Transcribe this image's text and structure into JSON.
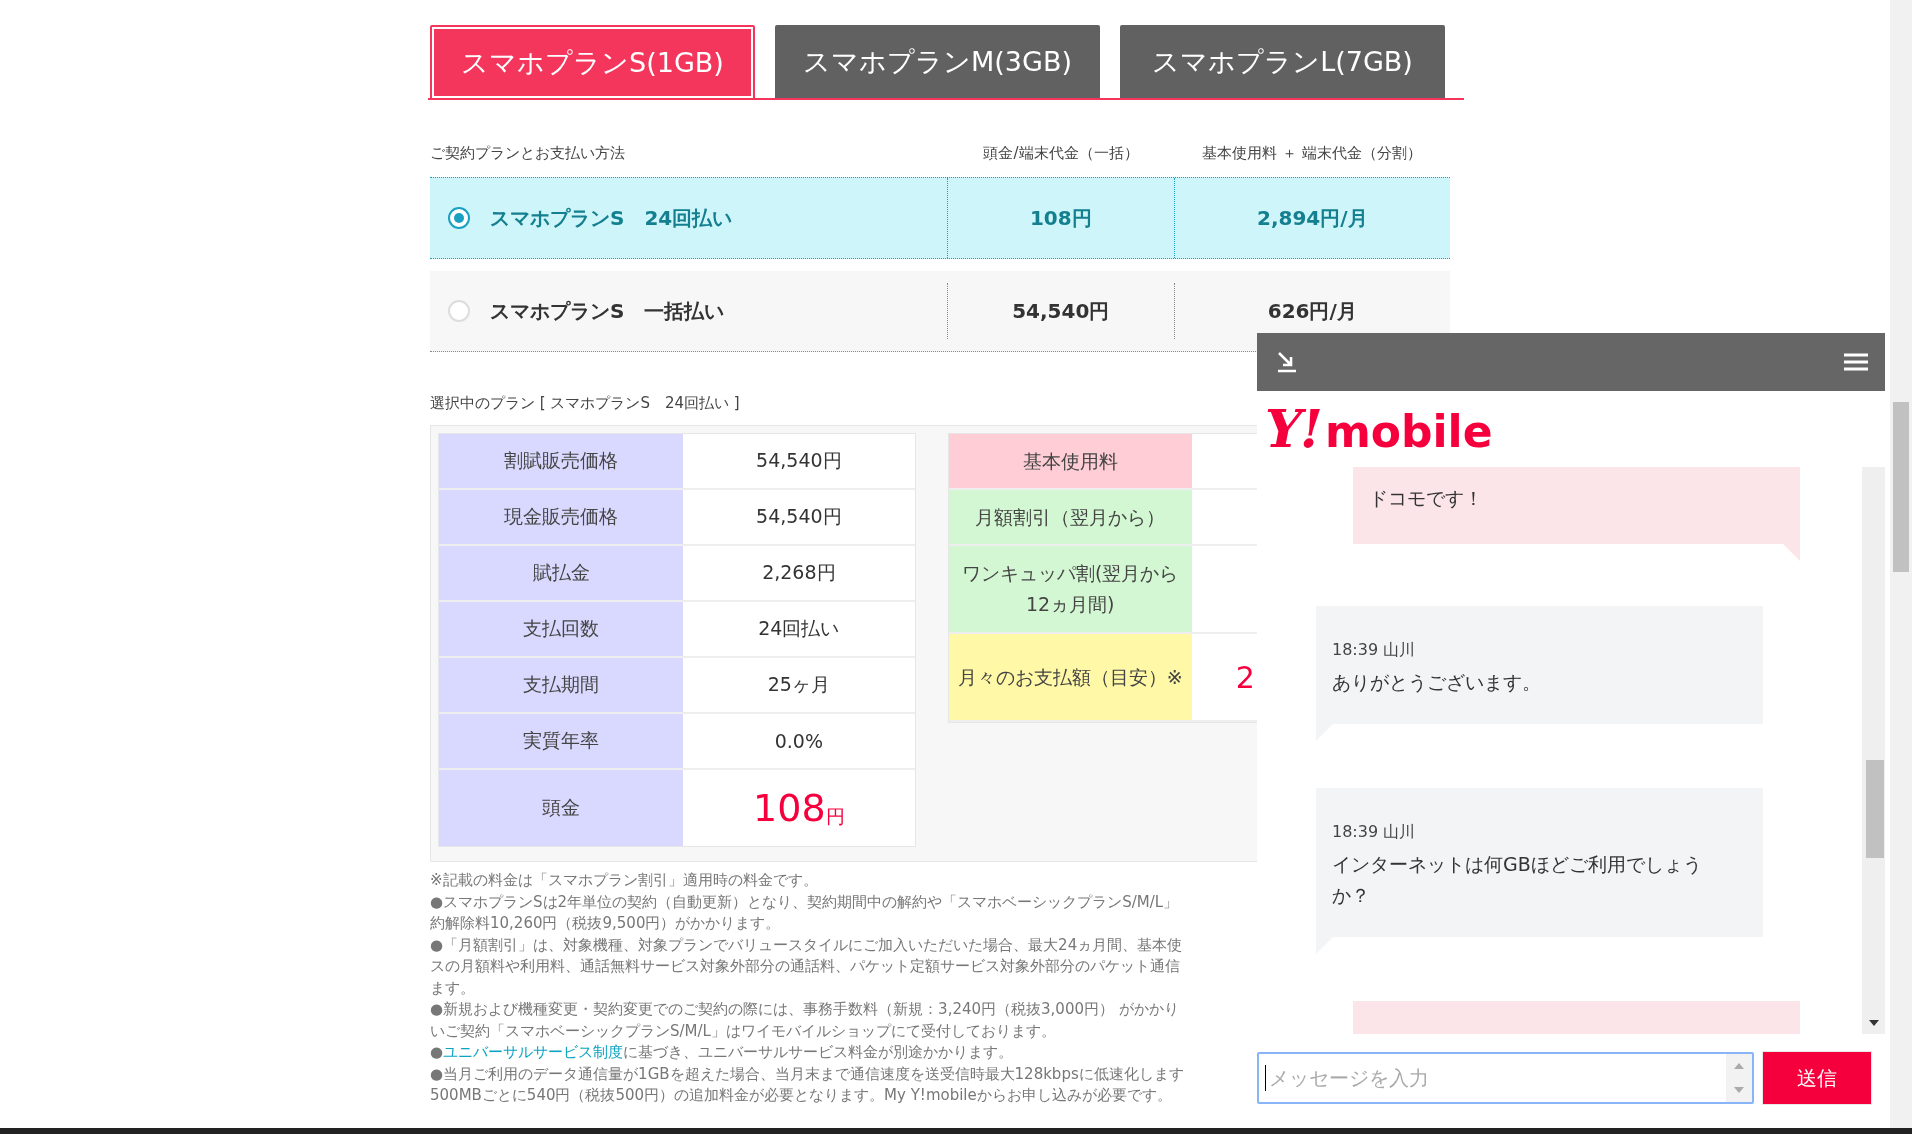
{
  "tabs": [
    {
      "label": "スマホプランS(1GB)",
      "selected": true
    },
    {
      "label": "スマホプランM(3GB)",
      "selected": false
    },
    {
      "label": "スマホプランL(7GB)",
      "selected": false
    }
  ],
  "plan_table": {
    "columns": [
      "ご契約プランとお支払い方法",
      "頭金/端末代金（一括）",
      "基本使用料 ＋ 端末代金（分割）"
    ],
    "rows": [
      {
        "plan": "スマホプランS　24回払い",
        "down_payment": "108円",
        "monthly": "2,894円/月",
        "selected": true
      },
      {
        "plan": "スマホプランS　一括払い",
        "down_payment": "54,540円",
        "monthly": "626円/月",
        "selected": false
      }
    ]
  },
  "selected_plan": "選択中のプラン [ スマホプランS　24回払い ]",
  "price_table": [
    {
      "kind": "normal",
      "label": "割賦販売価格",
      "value": "54,540円"
    },
    {
      "kind": "normal",
      "label": "現金販売価格",
      "value": "54,540円"
    },
    {
      "kind": "normal",
      "label": "賦払金",
      "value": "2,268円"
    },
    {
      "kind": "normal",
      "label": "支払回数",
      "value": "24回払い"
    },
    {
      "kind": "normal",
      "label": "支払期間",
      "value": "25ヶ月"
    },
    {
      "kind": "normal",
      "label": "実質年率",
      "value": "0.0%"
    },
    {
      "kind": "highlight",
      "label": "頭金",
      "value": "108",
      "unit": "円"
    }
  ],
  "fee_table": [
    {
      "label": "基本使用料",
      "color": "#ffcdd6"
    },
    {
      "label": "月額割引（翌月から）",
      "color": "#d3f7d3"
    },
    {
      "label": "ワンキュッパ割(翌月から12ヵ月間)",
      "color": "#d3f7d3"
    },
    {
      "label": "月々のお支払額（目安）※",
      "color": "#fff8a6",
      "value": "2"
    }
  ],
  "notes": [
    {
      "text": "※記載の料金は「スマホプラン割引」適用時の料金です。"
    },
    {
      "text": "●スマホプランSは2年単位の契約（自動更新）となり、契約期間中の解約や「スマホベーシックプランS/M/L」"
    },
    {
      "text": "約解除料10,260円（税抜9,500円）がかかります。"
    },
    {
      "text": "●「月額割引」は、対象機種、対象プランでバリュースタイルにご加入いただいた場合、最大24ヵ月間、基本使"
    },
    {
      "text": "スの月額料や利用料、通話無料サービス対象外部分の通話料、パケット定額サービス対象外部分のパケット通信"
    },
    {
      "text": "ます。"
    },
    {
      "text": "●新規および機種変更・契約変更でのご契約の際には、事務手数料（新規：3,240円（税抜3,000円） がかかり"
    },
    {
      "text": "いご契約「スマホベーシックプランS/M/L」はワイモバイルショップにて受付しております。"
    },
    {
      "prefix": "●",
      "link": "ユニバーサルサービス制度",
      "text": "に基づき、ユニバーサルサービス料金が別途かかります。"
    },
    {
      "text": "●当月ご利用のデータ通信量が1GBを超えた場合、当月末まで通信速度を送受信時最大128kbpsに低速化します"
    },
    {
      "text": "500MBごとに540円（税抜500円）の追加料金が必要となります。My Y!mobileからお申し込みが必要です。"
    }
  ],
  "chat": {
    "logo": {
      "mark": "Y!",
      "word": "mobile"
    },
    "messages": [
      {
        "kind": "user",
        "text": "ドコモです！"
      },
      {
        "kind": "agent",
        "meta": "18:39 山川",
        "text": "ありがとうございます。"
      },
      {
        "kind": "agent",
        "meta": "18:39 山川",
        "text": "インターネットは何GBほどご利用でしょうか？"
      },
      {
        "kind": "user"
      }
    ],
    "input": {
      "placeholder": "メッセージを入力"
    },
    "send": "送信"
  }
}
